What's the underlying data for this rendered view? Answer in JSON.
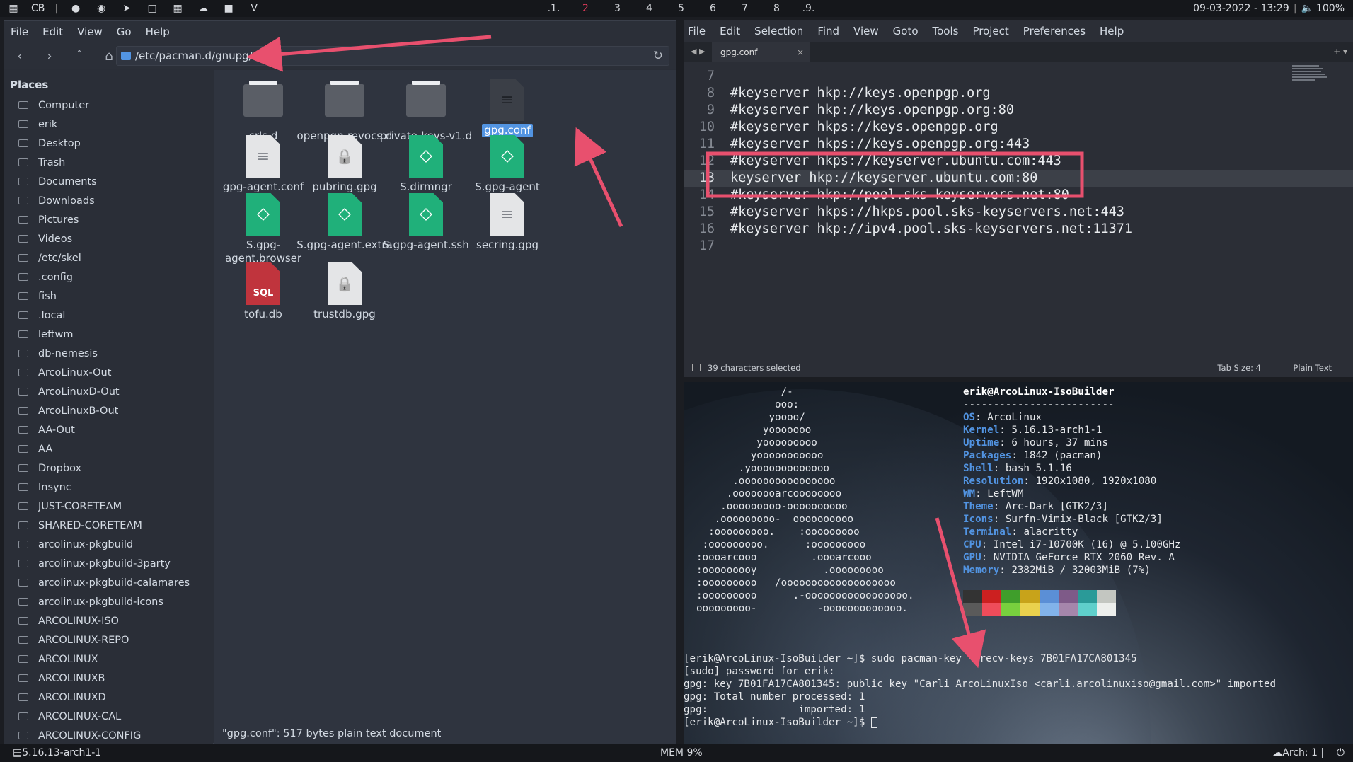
{
  "topbar": {
    "launcher": "CB",
    "workspaces": [
      ".1.",
      "2",
      "3",
      "4",
      "5",
      "6",
      "7",
      "8",
      ".9."
    ],
    "datetime": "09-03-2022 - 13:29",
    "volume": "100%"
  },
  "file_manager": {
    "menu": [
      "File",
      "Edit",
      "View",
      "Go",
      "Help"
    ],
    "location": "/etc/pacman.d/gnupg/",
    "places_title": "Places",
    "places": [
      "Computer",
      "erik",
      "Desktop",
      "Trash",
      "Documents",
      "Downloads",
      "Pictures",
      "Videos",
      "/etc/skel",
      ".config",
      "fish",
      ".local",
      "leftwm",
      "db-nemesis",
      "ArcoLinux-Out",
      "ArcoLinuxD-Out",
      "ArcoLinuxB-Out",
      "AA-Out",
      "AA",
      "Dropbox",
      "Insync",
      "JUST-CORETEAM",
      "SHARED-CORETEAM",
      "arcolinux-pkgbuild",
      "arcolinux-pkgbuild-3party",
      "arcolinux-pkgbuild-calamares",
      "arcolinux-pkgbuild-icons",
      "ARCOLINUX-ISO",
      "ARCOLINUX-REPO",
      "ARCOLINUX",
      "ARCOLINUXB",
      "ARCOLINUXD",
      "ARCOLINUX-CAL",
      "ARCOLINUX-CONFIG"
    ],
    "files": [
      {
        "name": "crls.d",
        "kind": "folder"
      },
      {
        "name": "openpgp-revocs.d",
        "kind": "folder"
      },
      {
        "name": "private-keys-v1.d",
        "kind": "folder"
      },
      {
        "name": "gpg.conf",
        "kind": "text-dark",
        "selected": true
      },
      {
        "name": "gpg-agent.conf",
        "kind": "text"
      },
      {
        "name": "pubring.gpg",
        "kind": "lock"
      },
      {
        "name": "S.dirmngr",
        "kind": "socket"
      },
      {
        "name": "S.gpg-agent",
        "kind": "socket"
      },
      {
        "name": "S.gpg-agent.browser",
        "kind": "socket"
      },
      {
        "name": "S.gpg-agent.extra",
        "kind": "socket"
      },
      {
        "name": "S.gpg-agent.ssh",
        "kind": "socket"
      },
      {
        "name": "secring.gpg",
        "kind": "text"
      },
      {
        "name": "tofu.db",
        "kind": "sql"
      },
      {
        "name": "trustdb.gpg",
        "kind": "lock"
      }
    ],
    "status": "\"gpg.conf\": 517 bytes plain text document"
  },
  "editor": {
    "menu": [
      "File",
      "Edit",
      "Selection",
      "Find",
      "View",
      "Goto",
      "Tools",
      "Project",
      "Preferences",
      "Help"
    ],
    "tab": "gpg.conf",
    "lines": [
      {
        "n": "7",
        "text": ""
      },
      {
        "n": "8",
        "text": "#keyserver hkp://keys.openpgp.org"
      },
      {
        "n": "9",
        "text": "#keyserver hkp://keys.openpgp.org:80"
      },
      {
        "n": "10",
        "text": "#keyserver hkps://keys.openpgp.org"
      },
      {
        "n": "11",
        "text": "#keyserver hkps://keys.openpgp.org:443"
      },
      {
        "n": "12",
        "text": "#keyserver hkps://keyserver.ubuntu.com:443"
      },
      {
        "n": "13",
        "text": "keyserver hkp://keyserver.ubuntu.com:80",
        "current": true
      },
      {
        "n": "14",
        "text": "#keyserver hkp://pool.sks-keyservers.net:80"
      },
      {
        "n": "15",
        "text": "#keyserver hkps://hkps.pool.sks-keyservers.net:443"
      },
      {
        "n": "16",
        "text": "#keyserver hkp://ipv4.pool.sks-keyservers.net:11371"
      },
      {
        "n": "17",
        "text": ""
      }
    ],
    "status_left": "39 characters selected",
    "tab_size": "Tab Size: 4",
    "syntax": "Plain Text"
  },
  "terminal": {
    "ascii": [
      "              /-",
      "             ooo:",
      "            yoooo/",
      "           yooooooo",
      "          yooooooooo",
      "         yooooooooooo",
      "       .yooooooooooooo",
      "      .oooooooooooooooo",
      "     .oooooooarcoooooooo",
      "    .ooooooooo-oooooooooo",
      "   .ooooooooo-  oooooooooo",
      "  :ooooooooo.    :ooooooooo",
      " :ooooooooo.      :ooooooooo",
      ":oooarcooo         .oooarcooo",
      ":ooooooooy           .ooooooooo",
      ":ooooooooo   /ooooooooooooooooooo",
      ":ooooooooo      .-ooooooooooooooooo.",
      "ooooooooo-          -ooooooooooooo."
    ],
    "user_host": "erik@ArcoLinux-IsoBuilder",
    "separator": "-------------------------",
    "info": [
      {
        "k": "OS",
        "v": "ArcoLinux"
      },
      {
        "k": "Kernel",
        "v": "5.16.13-arch1-1"
      },
      {
        "k": "Uptime",
        "v": "6 hours, 37 mins"
      },
      {
        "k": "Packages",
        "v": "1842 (pacman)"
      },
      {
        "k": "Shell",
        "v": "bash 5.1.16"
      },
      {
        "k": "Resolution",
        "v": "1920x1080, 1920x1080"
      },
      {
        "k": "WM",
        "v": "LeftWM"
      },
      {
        "k": "Theme",
        "v": "Arc-Dark [GTK2/3]"
      },
      {
        "k": "Icons",
        "v": "Surfn-Vimix-Black [GTK2/3]"
      },
      {
        "k": "Terminal",
        "v": "alacritty"
      },
      {
        "k": "CPU",
        "v": "Intel i7-10700K (16) @ 5.100GHz"
      },
      {
        "k": "GPU",
        "v": "NVIDIA GeForce RTX 2060 Rev. A"
      },
      {
        "k": "Memory",
        "v": "2382MiB / 32003MiB (7%)"
      }
    ],
    "palette_top": [
      "#333333",
      "#cc2020",
      "#3f9e2b",
      "#c8a31a",
      "#5b8fd6",
      "#7e5a88",
      "#2a9a98",
      "#c3c6c1"
    ],
    "palette_bottom": [
      "#5a5a5a",
      "#ef4c5a",
      "#78d03e",
      "#ead14d",
      "#82b3ea",
      "#a586ab",
      "#5fcfcb",
      "#eceeec"
    ],
    "output": [
      "[erik@ArcoLinux-IsoBuilder ~]$ sudo pacman-key --recv-keys 7B01FA17CA801345",
      "[sudo] password for erik:",
      "gpg: key 7B01FA17CA801345: public key \"Carli ArcoLinuxIso <carli.arcolinuxiso@gmail.com>\" imported",
      "gpg: Total number processed: 1",
      "gpg:               imported: 1"
    ],
    "prompt": "[erik@ArcoLinux-IsoBuilder ~]$ "
  },
  "bottombar": {
    "kernel": "5.16.13-arch1-1",
    "mem": "MEM 9%",
    "arch": "Arch: 1 |"
  },
  "colors": {
    "accent": "#5294e2",
    "annotation": "#e8506e"
  }
}
